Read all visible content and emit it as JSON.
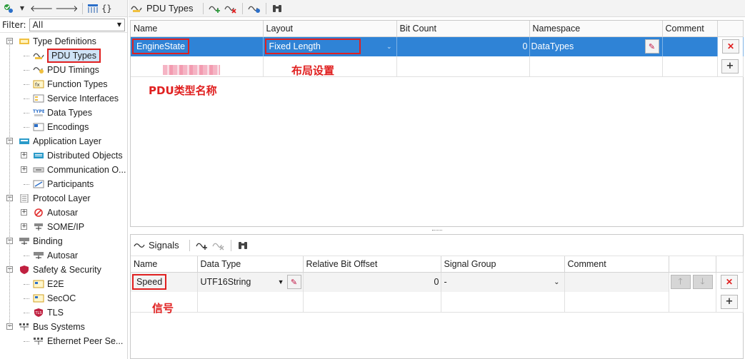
{
  "left": {
    "filter_label": "Filter:",
    "filter_value": "All",
    "tree": [
      {
        "label": "Type Definitions",
        "level": 0,
        "icon": "type-definitions-icon",
        "expander": "−"
      },
      {
        "label": "PDU Types",
        "level": 1,
        "icon": "pdu-types-icon",
        "selected": true
      },
      {
        "label": "PDU Timings",
        "level": 1,
        "icon": "pdu-timings-icon"
      },
      {
        "label": "Function Types",
        "level": 1,
        "icon": "function-types-icon"
      },
      {
        "label": "Service Interfaces",
        "level": 1,
        "icon": "service-interfaces-icon"
      },
      {
        "label": "Data Types",
        "level": 1,
        "icon": "data-types-icon"
      },
      {
        "label": "Encodings",
        "level": 1,
        "icon": "encodings-icon"
      },
      {
        "label": "Application Layer",
        "level": 0,
        "icon": "application-layer-icon",
        "expander": "−"
      },
      {
        "label": "Distributed Objects",
        "level": 1,
        "icon": "distributed-objects-icon",
        "expander": "+"
      },
      {
        "label": "Communication O...",
        "level": 1,
        "icon": "communication-icon",
        "expander": "+"
      },
      {
        "label": "Participants",
        "level": 1,
        "icon": "participants-icon"
      },
      {
        "label": "Protocol Layer",
        "level": 0,
        "icon": "protocol-layer-icon",
        "expander": "−"
      },
      {
        "label": "Autosar",
        "level": 1,
        "icon": "autosar-icon",
        "expander": "+"
      },
      {
        "label": "SOME/IP",
        "level": 1,
        "icon": "someip-icon",
        "expander": "+"
      },
      {
        "label": "Binding",
        "level": 0,
        "icon": "binding-icon",
        "expander": "−"
      },
      {
        "label": "Autosar",
        "level": 1,
        "icon": "autosar-binding-icon"
      },
      {
        "label": "Safety & Security",
        "level": 0,
        "icon": "shield-icon",
        "expander": "−"
      },
      {
        "label": "E2E",
        "level": 1,
        "icon": "e2e-icon"
      },
      {
        "label": "SecOC",
        "level": 1,
        "icon": "secoc-icon"
      },
      {
        "label": "TLS",
        "level": 1,
        "icon": "tls-icon"
      },
      {
        "label": "Bus Systems",
        "level": 0,
        "icon": "bus-systems-icon",
        "expander": "−"
      },
      {
        "label": "Ethernet Peer Se...",
        "level": 1,
        "icon": "ethernet-icon"
      }
    ]
  },
  "top_toolbar": {
    "title": "PDU Types"
  },
  "pdu_grid": {
    "columns": [
      "Name",
      "Layout",
      "Bit Count",
      "Namespace",
      "Comment"
    ],
    "rows": [
      {
        "name": "EngineState",
        "layout": "Fixed Length",
        "bit_count": "0",
        "namespace": "DataTypes",
        "comment": ""
      }
    ]
  },
  "annotations": {
    "layout_note": "布局设置",
    "pdu_name_note": "PDU类型名称",
    "signal_note": "信号"
  },
  "signals": {
    "title": "Signals",
    "columns": [
      "Name",
      "Data Type",
      "Relative Bit Offset",
      "Signal Group",
      "Comment"
    ],
    "rows": [
      {
        "name": "Speed",
        "data_type": "UTF16String",
        "offset": "0",
        "group": "-",
        "comment": ""
      }
    ]
  },
  "colors": {
    "selection": "#2f83d6",
    "annotation_red": "#e02020"
  }
}
